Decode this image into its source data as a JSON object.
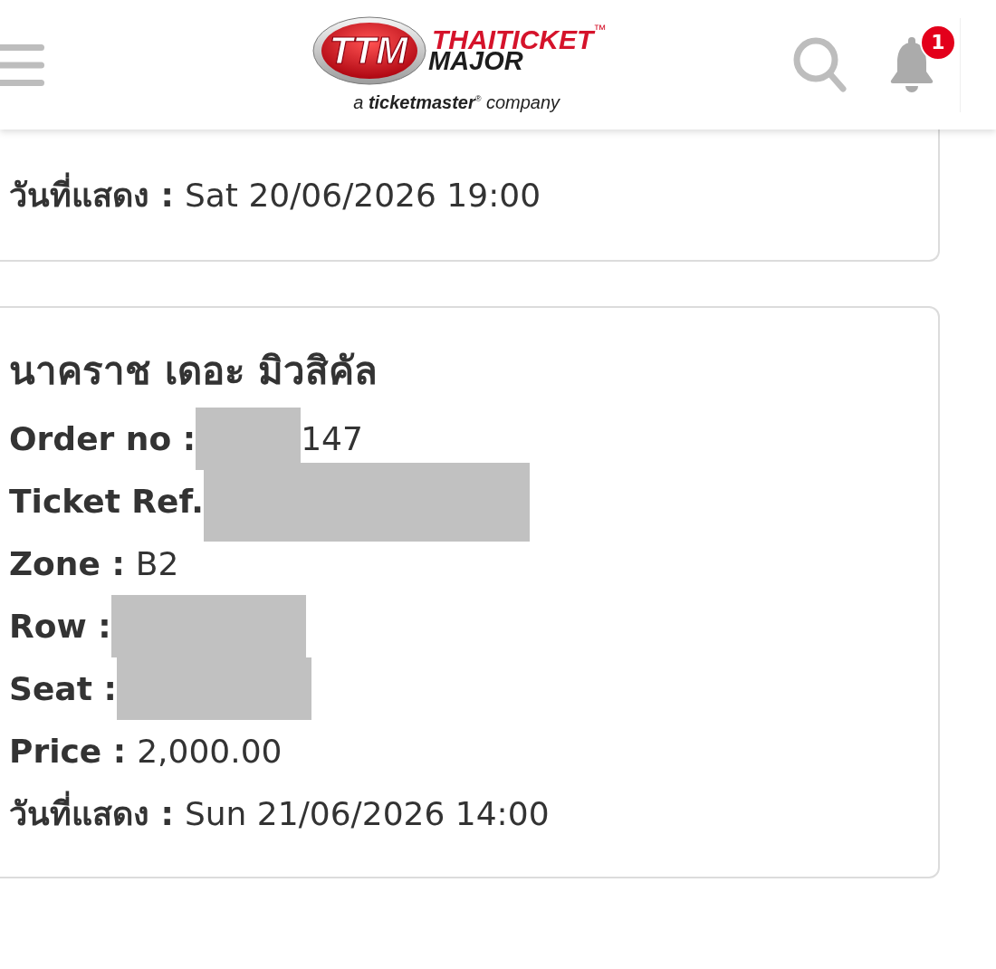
{
  "header": {
    "logo": {
      "emblem": "TTM",
      "wordmark": "THAITICKET$^{™}$",
      "wordmark_line_2": "MAJOR",
      "tagline": "a **ticketmaster**$^{®}$ company"
    },
    "notification_count": "1"
  },
  "tickets": [
    {
      "fields": [
        {
          "kind": "plain",
          "label": "วันที่แสดง :",
          "value": "Sat 20/06/2026 19:00"
        }
      ]
    },
    {
      "title": "นาคราช เดอะ มิวสิคัล",
      "fields": [
        {
          "kind": "partial",
          "label": "Order no :",
          "value": "147"
        },
        {
          "kind": "wide",
          "label": "Ticket Ref."
        },
        {
          "kind": "plain",
          "label": "Zone :",
          "value": "B2"
        },
        {
          "kind": "masked",
          "label": "Row :"
        },
        {
          "kind": "masked",
          "label": "Seat :"
        },
        {
          "kind": "plain",
          "label": "Price :",
          "value": "2,000.00"
        },
        {
          "kind": "plain",
          "label": "วันที่แสดง :",
          "value": "Sun 21/06/2026 14:00"
        }
      ]
    }
  ]
}
